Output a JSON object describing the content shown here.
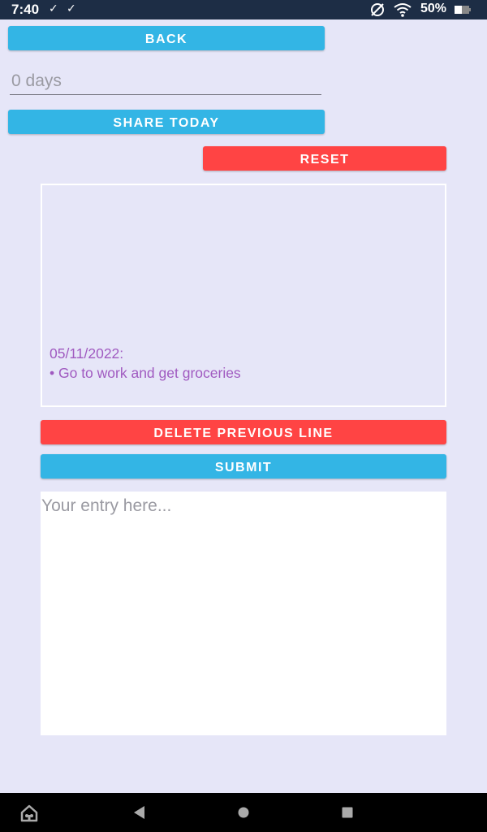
{
  "status_bar": {
    "time": "7:40",
    "battery_percent": "50%",
    "check_glyph": "✓",
    "icons": [
      "check-icon",
      "check-icon",
      "no-sim-icon",
      "wifi-icon",
      "battery-icon"
    ]
  },
  "buttons": {
    "back": "BACK",
    "share_today": "SHARE TODAY",
    "reset": "RESET",
    "delete_previous_line": "DELETE PREVIOUS LINE",
    "submit": "SUBMIT"
  },
  "days_field": {
    "placeholder": "0 days"
  },
  "log": {
    "date_line": "05/11/2022:",
    "entry_line": "• Go to work and get groceries"
  },
  "entry_input": {
    "placeholder": "Your entry here..."
  },
  "nav_bar": {
    "icons": [
      "home-icon",
      "back-triangle-icon",
      "home-circle-icon",
      "recents-square-icon"
    ]
  },
  "colors": {
    "background": "#e6e6f8",
    "status_bar": "#1d2d45",
    "primary_button": "#33b5e5",
    "danger_button": "#ff4444",
    "log_text": "#a05ac0"
  }
}
